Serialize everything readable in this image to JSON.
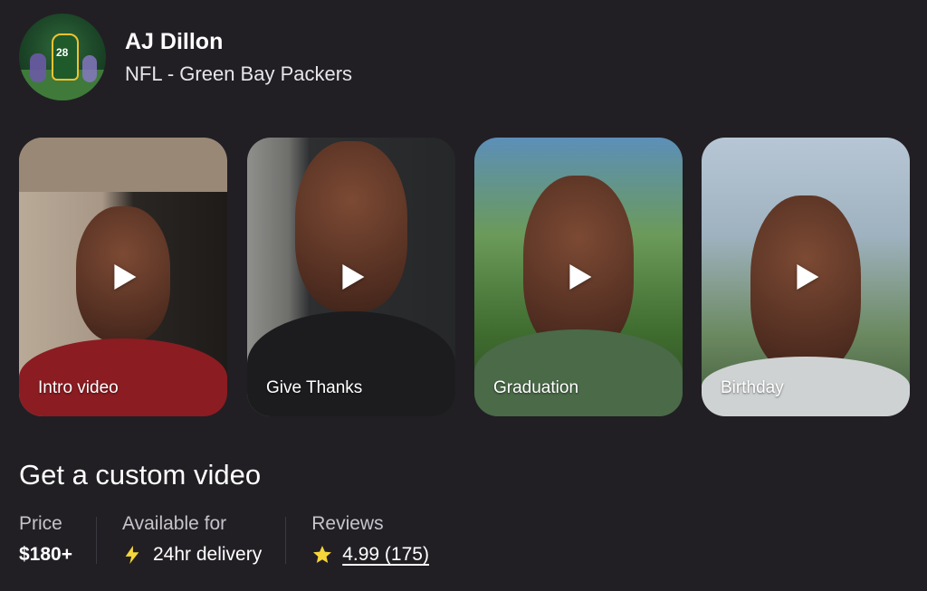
{
  "profile": {
    "name": "AJ Dillon",
    "subtitle": "NFL - Green Bay Packers",
    "avatar_jersey_number": "28"
  },
  "videos": [
    {
      "label": "Intro video"
    },
    {
      "label": "Give Thanks"
    },
    {
      "label": "Graduation"
    },
    {
      "label": "Birthday"
    }
  ],
  "section_title": "Get a custom video",
  "stats": {
    "price": {
      "label": "Price",
      "value": "$180+"
    },
    "availability": {
      "label": "Available for",
      "value": "24hr delivery",
      "icon": "lightning-bolt-icon"
    },
    "reviews": {
      "label": "Reviews",
      "value": "4.99 (175)",
      "icon": "star-icon"
    }
  },
  "colors": {
    "background": "#211f24",
    "text": "#ffffff",
    "muted_text": "#c5c4ca",
    "accent_yellow": "#f6d63a"
  }
}
